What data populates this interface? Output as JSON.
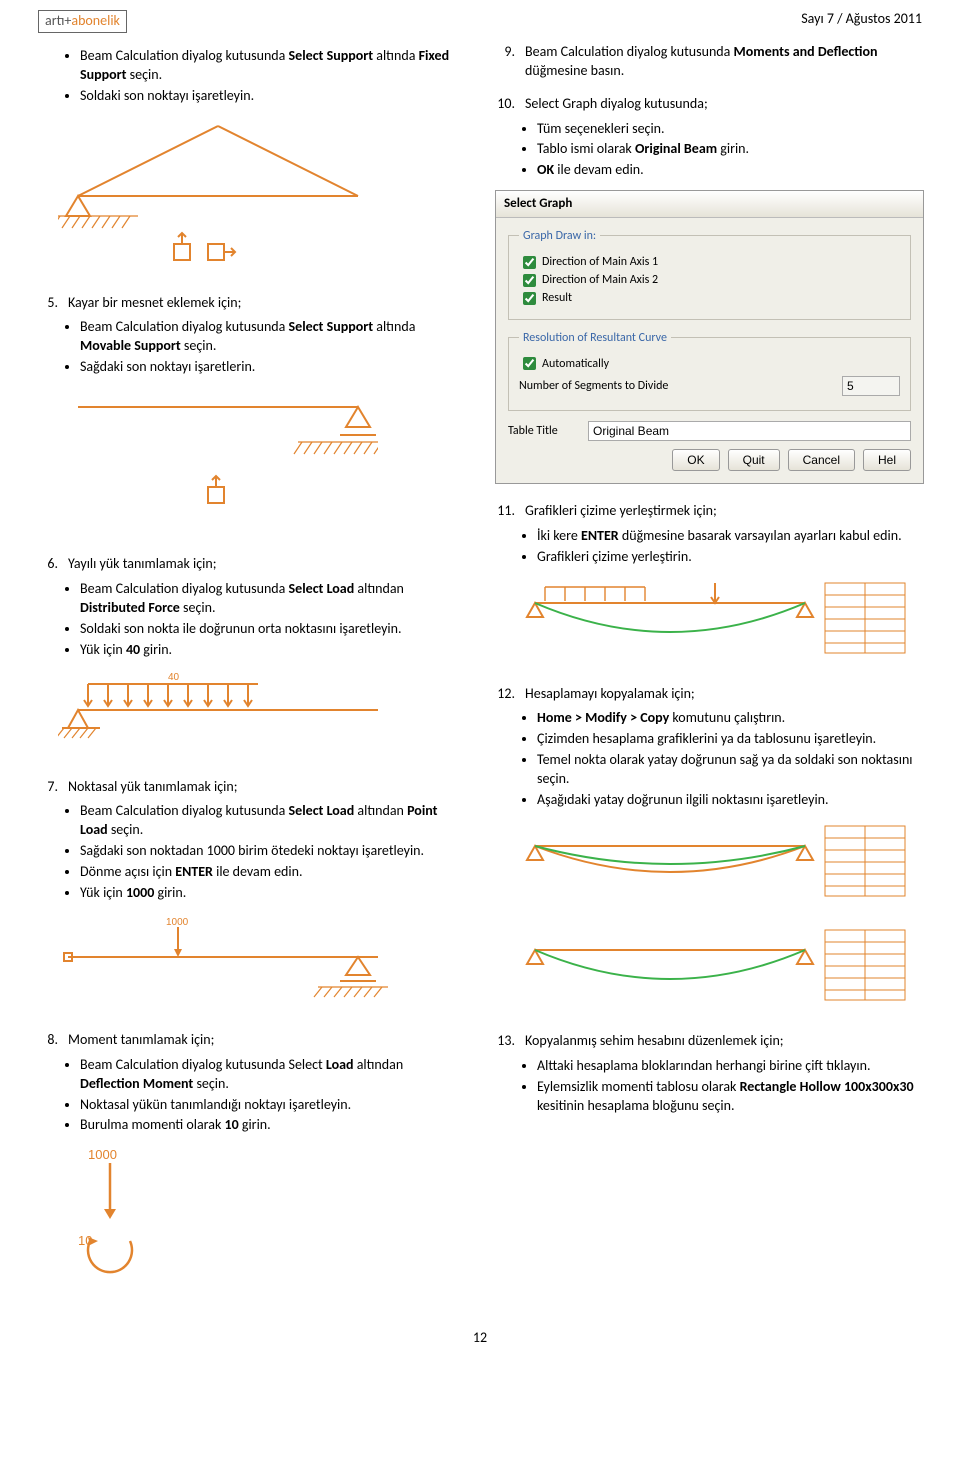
{
  "header": {
    "logo_a": "artı+",
    "logo_b": "abonelik",
    "issue": "Sayı 7 / Ağustos 2011"
  },
  "left": {
    "s4": {
      "l1": "Beam Calculation diyalog kutusunda ",
      "b1": "Select Support",
      "l2": " altında ",
      "b2": "Fixed Support",
      "l3": " seçin.",
      "l4": "Soldaki son noktayı işaretleyin."
    },
    "s5": {
      "head": "Kayar bir mesnet eklemek için;",
      "l1": "Beam Calculation diyalog kutusunda ",
      "b1": "Select Support",
      "l2": " altında ",
      "b2": "Movable Support",
      "l3": " seçin.",
      "l4": "Sağdaki son noktayı işaretlerin."
    },
    "s6": {
      "head": "Yayılı yük tanımlamak için;",
      "l1": "Beam Calculation diyalog kutusunda ",
      "b1": "Select Load",
      "l2": " altından ",
      "b2": "Distributed Force",
      "l3": " seçin.",
      "l4": "Soldaki son nokta ile doğrunun orta noktasını işaretleyin.",
      "l5": "Yük için ",
      "b5": "40",
      "l6": " girin."
    },
    "s7": {
      "head": "Noktasal yük tanımlamak için;",
      "l1": "Beam Calculation diyalog kutusunda ",
      "b1": "Select Load",
      "l2": " altından ",
      "b2": "Point Load",
      "l3": " seçin.",
      "l4": "Sağdaki son noktadan 1000 birim ötedeki noktayı işaretleyin.",
      "l5": "Dönme açısı için ",
      "b5": "ENTER",
      "l6": " ile devam edin.",
      "l7": "Yük için ",
      "b7": "1000",
      "l8": " girin."
    },
    "s8": {
      "head": "Moment tanımlamak için;",
      "l1": "Beam Calculation diyalog kutusunda Select ",
      "b1": "Load",
      "l2": " altından ",
      "b2": "Deflection Moment",
      "l3": " seçin.",
      "l4": "Noktasal yükün tanımlandığı noktayı işaretleyin.",
      "l5": "Burulma momenti olarak ",
      "b5": "10",
      "l6": " girin.",
      "fignum": "1000",
      "figten": "10"
    }
  },
  "right": {
    "s9": {
      "l1": "Beam Calculation diyalog kutusunda ",
      "b1": "Moments and Deflection",
      "l2": " düğmesine basın."
    },
    "s10": {
      "head": "Select Graph diyalog kutusunda;",
      "l1": "Tüm seçenekleri seçin.",
      "l2": "Tablo ismi olarak ",
      "b2": "Original Beam",
      "l3": " girin.",
      "l4a": "OK",
      "l4b": " ile devam edin."
    },
    "s11": {
      "head": "Grafikleri çizime yerleştirmek için;",
      "l1": "İki kere ",
      "b1": "ENTER",
      "l2": " düğmesine basarak varsayılan ayarları kabul edin.",
      "l3": "Grafikleri çizime yerleştirin."
    },
    "s12": {
      "head": "Hesaplamayı kopyalamak için;",
      "l1a": "Home > Modify > Copy",
      "l1b": " komutunu çalıştırın.",
      "l2": "Çizimden hesaplama grafiklerini ya da tablosunu işaretleyin.",
      "l3": "Temel nokta olarak yatay doğrunun sağ ya da soldaki son noktasını seçin.",
      "l4": "Aşağıdaki yatay doğrunun ilgili noktasını işaretleyin."
    },
    "s13": {
      "head": "Kopyalanmış sehim hesabını düzenlemek için;",
      "l1": "Alttaki hesaplama bloklarından herhangi birine çift tıklayın.",
      "l2": "Eylemsizlik momenti tablosu olarak ",
      "b2": "Rectangle Hollow 100x300x30",
      "l3": " kesitinin hesaplama bloğunu seçin."
    }
  },
  "dialog": {
    "title": "Select Graph",
    "legend1": "Graph Draw in:",
    "c1": "Direction of Main Axis 1",
    "c2": "Direction of Main Axis 2",
    "c3": "Result",
    "legend2": "Resolution of Resultant Curve",
    "c4": "Automatically",
    "seg": "Number of Segments to Divide",
    "segval": "5",
    "tlabel": "Table Title",
    "tval": "Original Beam",
    "ok": "OK",
    "quit": "Quit",
    "cancel": "Cancel",
    "help": "Hel"
  },
  "pagenum": "12"
}
